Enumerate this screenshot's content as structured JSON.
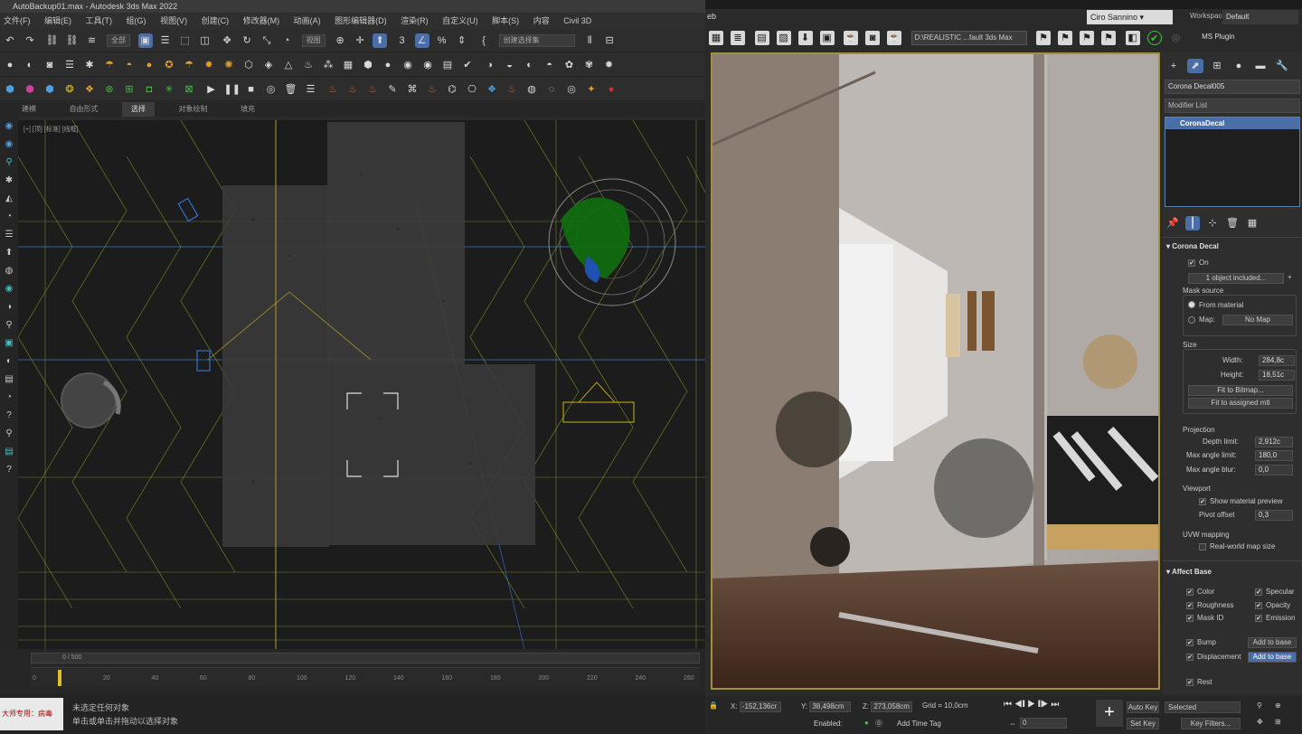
{
  "left_app": {
    "title": "AutoBackup01.max - Autodesk 3ds Max 2022",
    "menu": [
      "文件(F)",
      "编辑(E)",
      "工具(T)",
      "组(G)",
      "视图(V)",
      "创建(C)",
      "修改器(M)",
      "动画(A)",
      "图形编辑器(D)",
      "渲染(R)",
      "自定义(U)",
      "脚本(S)",
      "内容",
      "Civil 3D"
    ],
    "toolbar1": {
      "filter": "全部",
      "refcoord": "视图",
      "selset": "创建选择集"
    },
    "ribbon_tabs": [
      "建模",
      "自由形式",
      "选择",
      "对象绘制",
      "填充"
    ],
    "ribbon_active": 2,
    "viewport_label": "[+] [顶] [标准] [线框]",
    "timeslider": "0 / 500",
    "ruler_ticks": [
      "0",
      "20",
      "40",
      "60",
      "80",
      "100",
      "120",
      "140",
      "160",
      "180",
      "200",
      "220",
      "240",
      "260"
    ],
    "maxscript": "大师专用：病毒",
    "status_line1": "未选定任何对象",
    "status_line2": "单击或单击并拖动以选择对象"
  },
  "fb": {
    "title": "eb",
    "user": "Ciro Sannino",
    "workspaces_label": "Workspaces:",
    "workspace": "Default",
    "path": "D:\\REALISTIC ...fault 3ds Max",
    "ms_plugin": "MS Plugin"
  },
  "cmd": {
    "object_name": "Corona Decal005",
    "modifier_list": "Modifier List",
    "stack_item": "CoronaDecal",
    "rollout": "Corona Decal",
    "on": "On",
    "included": "1 object included...",
    "mask_source": "Mask source",
    "from_material": "From material",
    "map": "Map:",
    "no_map": "No Map",
    "size": "Size",
    "width_label": "Width:",
    "width": "284,8c",
    "height_label": "Height:",
    "height": "18,51c",
    "fit_bitmap": "Fit to Bitmap...",
    "fit_mtl": "Fit to assigned mtl",
    "projection": "Projection",
    "depth_label": "Depth limit:",
    "depth": "2,912c",
    "maxangle_label": "Max angle limit:",
    "maxangle": "180,0",
    "blur_label": "Max angle blur:",
    "blur": "0,0",
    "viewport": "Viewport",
    "show_preview": "Show material preview",
    "pivot_label": "Pivot offset",
    "pivot": "0,3",
    "uvw": "UVW mapping",
    "realworld": "Real-world map size",
    "affect_base": "Affect Base",
    "color": "Color",
    "specular": "Specular",
    "roughness": "Roughness",
    "opacity": "Opacity",
    "maskid": "Mask ID",
    "emission": "Emission",
    "bump": "Bump",
    "displacement": "Displacement",
    "add_base": "Add to base",
    "rest": "Rest"
  },
  "bottom": {
    "x": "-152,136cr",
    "y": "38,498cm",
    "z": "273,058cm",
    "grid": "Grid = 10,0cm",
    "enabled": "Enabled:",
    "add_time_tag": "Add Time Tag",
    "auto_key": "Auto Key",
    "set_key": "Set Key",
    "selected": "Selected",
    "key_filters": "Key Filters...",
    "frame": "0"
  },
  "colors": {
    "accent": "#4a6fa8",
    "render_border": "#a09040",
    "grid_green": "#b0d020"
  }
}
